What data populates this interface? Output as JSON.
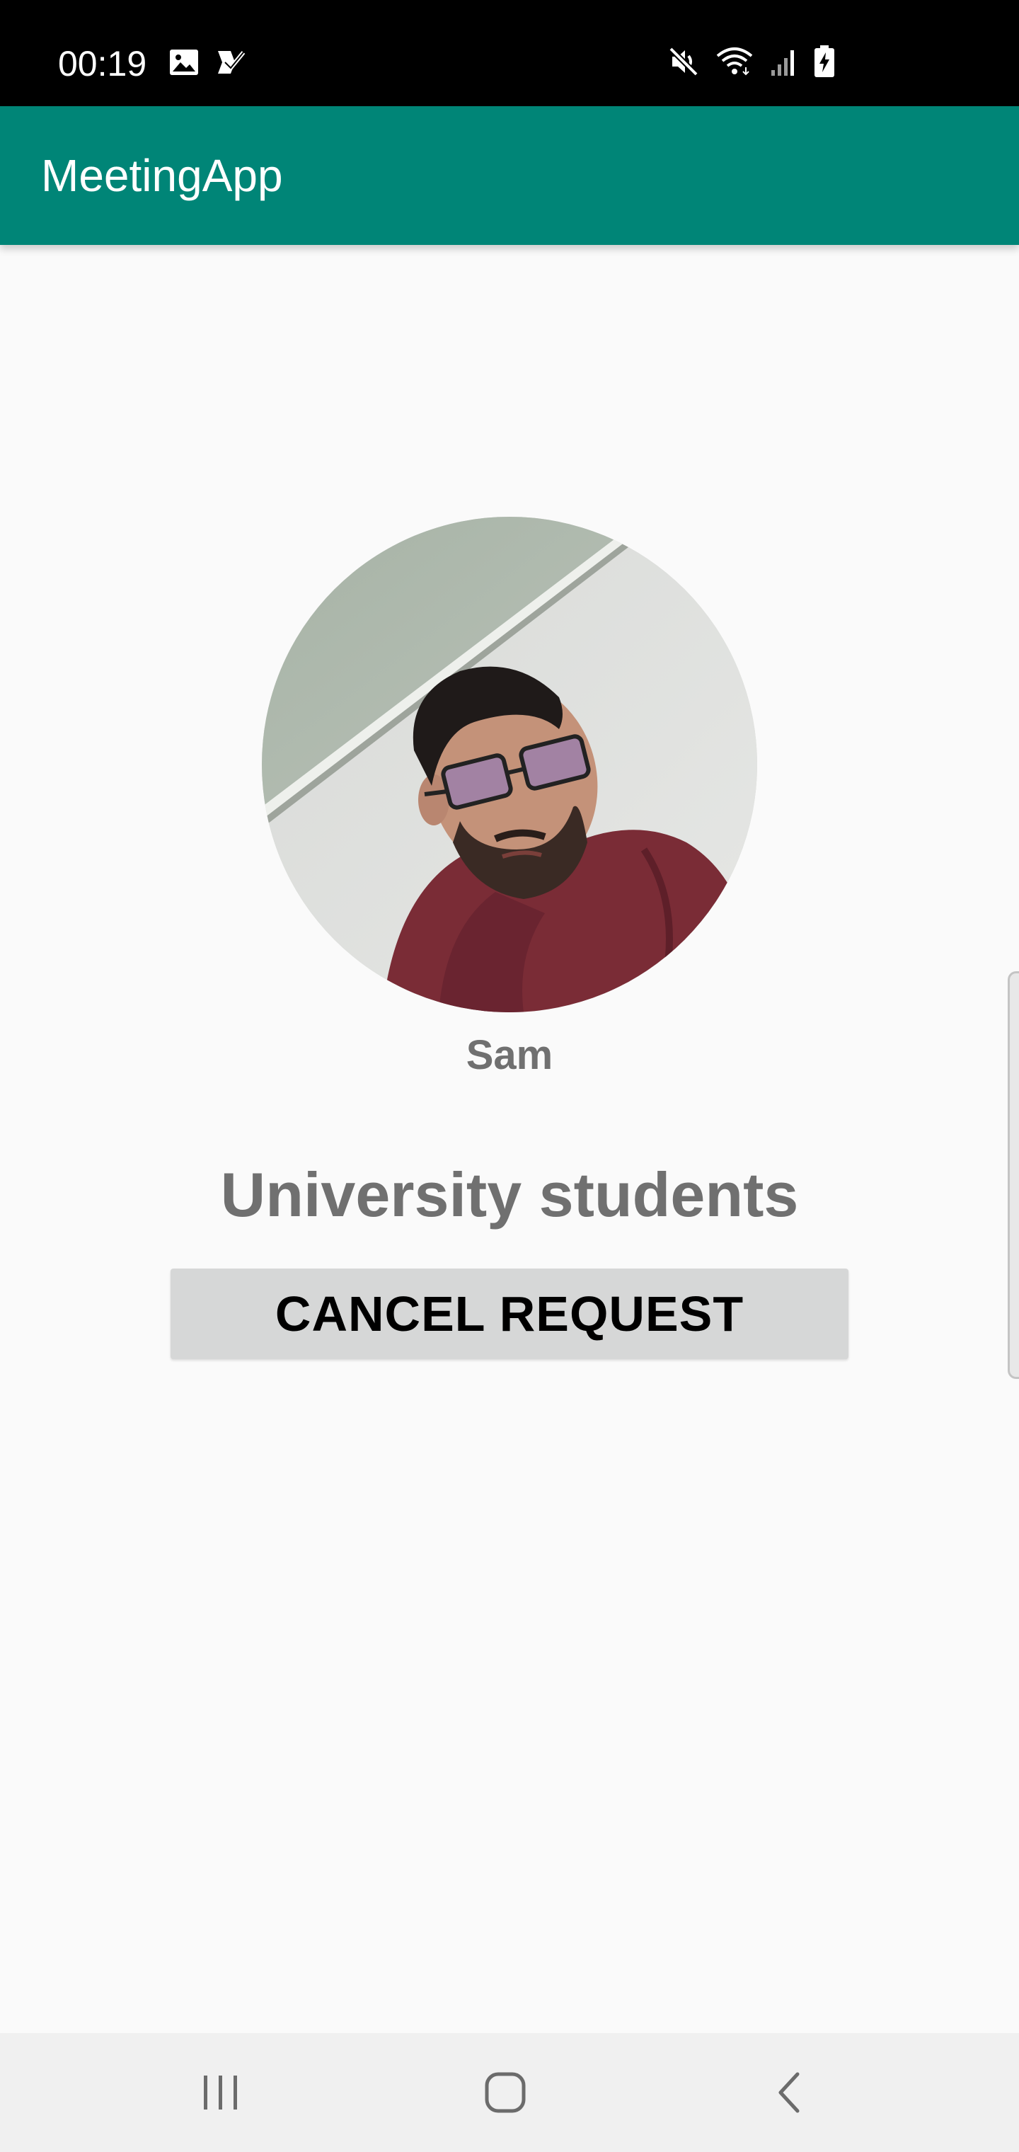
{
  "status_bar": {
    "time": "00:19",
    "left_icons": [
      "gallery-icon",
      "task-check-icon"
    ],
    "right_icons": [
      "mute-icon",
      "wifi-icon",
      "signal-icon",
      "battery-charging-icon"
    ],
    "background": "#000000"
  },
  "app_bar": {
    "title": "MeetingApp",
    "color": "#008577"
  },
  "profile": {
    "name": "Sam",
    "avatar_icon": "profile-photo"
  },
  "group": {
    "name": "University students"
  },
  "actions": {
    "cancel_request_label": "CANCEL REQUEST"
  },
  "nav_bar": {
    "buttons": [
      "recent-apps-icon",
      "home-icon",
      "back-icon"
    ]
  }
}
